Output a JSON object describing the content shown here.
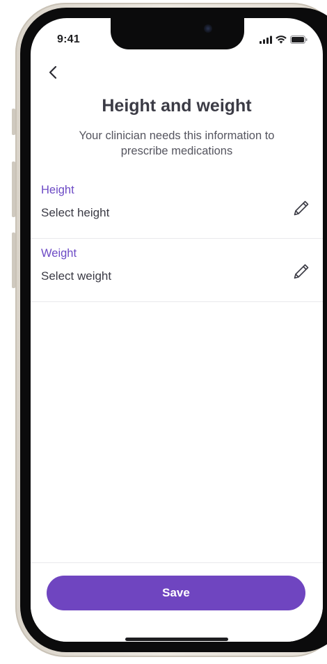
{
  "status_bar": {
    "time": "9:41",
    "icons": [
      "cellular-signal-icon",
      "wifi-icon",
      "battery-icon"
    ]
  },
  "header": {
    "back_icon": "chevron-left-icon",
    "title": "Height and weight",
    "subtitle": "Your clinician needs this information to prescribe medications"
  },
  "fields": [
    {
      "label": "Height",
      "placeholder": "Select height",
      "icon": "pencil-icon"
    },
    {
      "label": "Weight",
      "placeholder": "Select weight",
      "icon": "pencil-icon"
    }
  ],
  "footer": {
    "save_label": "Save"
  },
  "colors": {
    "accent": "#6f45c0",
    "label": "#6c4ac5",
    "title": "#3b3b45",
    "text": "#3a3a44"
  }
}
